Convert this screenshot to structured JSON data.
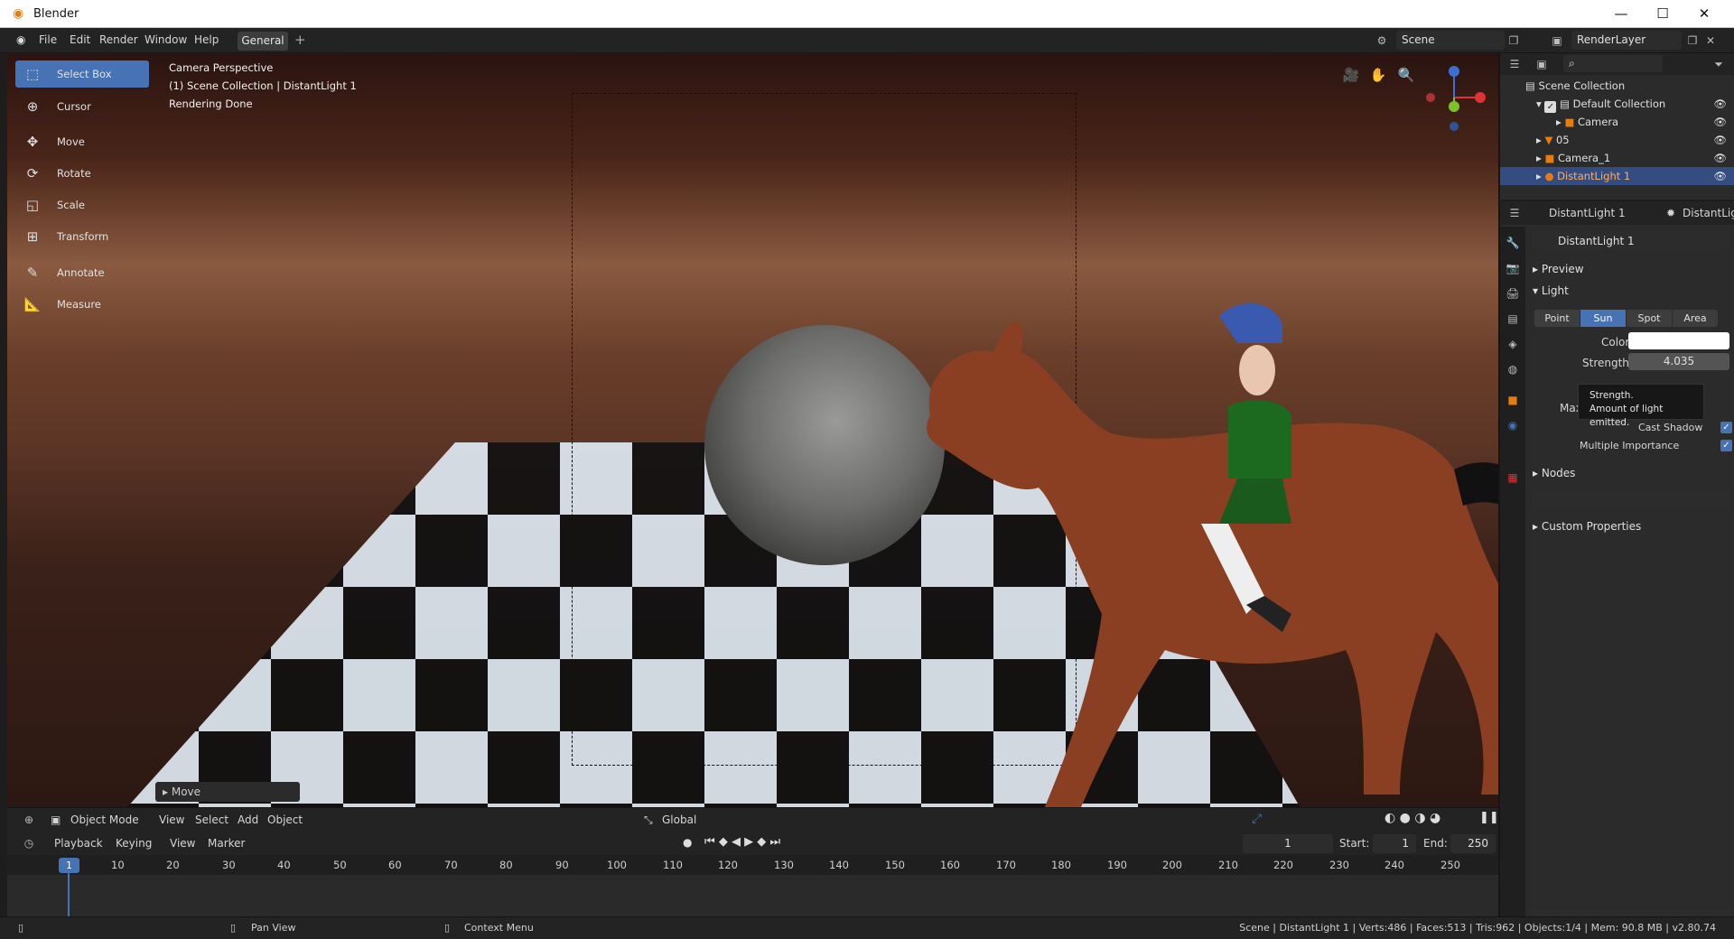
{
  "window": {
    "title": "Blender",
    "minimize": "—",
    "maximize": "☐",
    "close": "✕"
  },
  "menu": {
    "file": "File",
    "edit": "Edit",
    "render": "Render",
    "window": "Window",
    "help": "Help",
    "workspace": "General",
    "add_workspace": "+"
  },
  "scene": {
    "name": "Scene",
    "render_layer": "RenderLayer"
  },
  "tools": [
    {
      "label": "Select Box",
      "icon": "select-box-icon"
    },
    {
      "label": "Cursor",
      "icon": "cursor-icon"
    },
    {
      "label": "Move",
      "icon": "move-icon"
    },
    {
      "label": "Rotate",
      "icon": "rotate-icon"
    },
    {
      "label": "Scale",
      "icon": "scale-icon"
    },
    {
      "label": "Transform",
      "icon": "transform-icon"
    },
    {
      "label": "Annotate",
      "icon": "annotate-icon"
    },
    {
      "label": "Measure",
      "icon": "measure-icon"
    }
  ],
  "viewport": {
    "info_line1": "Camera Perspective",
    "info_line2": "(1) Scene Collection | DistantLight 1",
    "info_line3": "Rendering Done",
    "last_op": "Move"
  },
  "viewport_header": {
    "mode": "Object Mode",
    "view": "View",
    "select": "Select",
    "add": "Add",
    "object": "Object",
    "orientation": "Global"
  },
  "timeline": {
    "playback": "Playback",
    "keying": "Keying",
    "view": "View",
    "marker": "Marker",
    "current_frame": "1",
    "start_label": "Start:",
    "start": "1",
    "end_label": "End:",
    "end": "250",
    "ticks": [
      "10",
      "20",
      "30",
      "40",
      "50",
      "60",
      "70",
      "80",
      "90",
      "100",
      "110",
      "120",
      "130",
      "140",
      "150",
      "160",
      "170",
      "180",
      "190",
      "200",
      "210",
      "220",
      "230",
      "240",
      "250"
    ]
  },
  "status": {
    "pan": "Pan View",
    "context": "Context Menu",
    "stats": "Scene | DistantLight 1 | Verts:486 | Faces:513 | Tris:962 | Objects:1/4 | Mem: 90.8 MB | v2.80.74"
  },
  "outliner": {
    "root": "Scene Collection",
    "items": [
      {
        "label": "Default Collection"
      },
      {
        "label": "Camera"
      },
      {
        "label": "05"
      },
      {
        "label": "Camera_1"
      },
      {
        "label": "DistantLight 1"
      }
    ]
  },
  "properties": {
    "object_name": "DistantLight 1",
    "data_name": "DistantLight",
    "light_data": "DistantLight 1",
    "preview": "Preview",
    "light": "Light",
    "types": [
      "Point",
      "Sun",
      "Spot",
      "Area"
    ],
    "color_label": "Color",
    "strength_label": "Strength",
    "strength": "4.035",
    "max_label": "Max",
    "cast_shadow": "Cast Shadow",
    "multiple_importance": "Multiple Importance",
    "nodes": "Nodes",
    "custom_props": "Custom Properties",
    "tooltip_title": "Strength.",
    "tooltip_desc": "Amount of light emitted."
  },
  "colors": {
    "accent": "#4772b3",
    "orange": "#e87d0d"
  }
}
